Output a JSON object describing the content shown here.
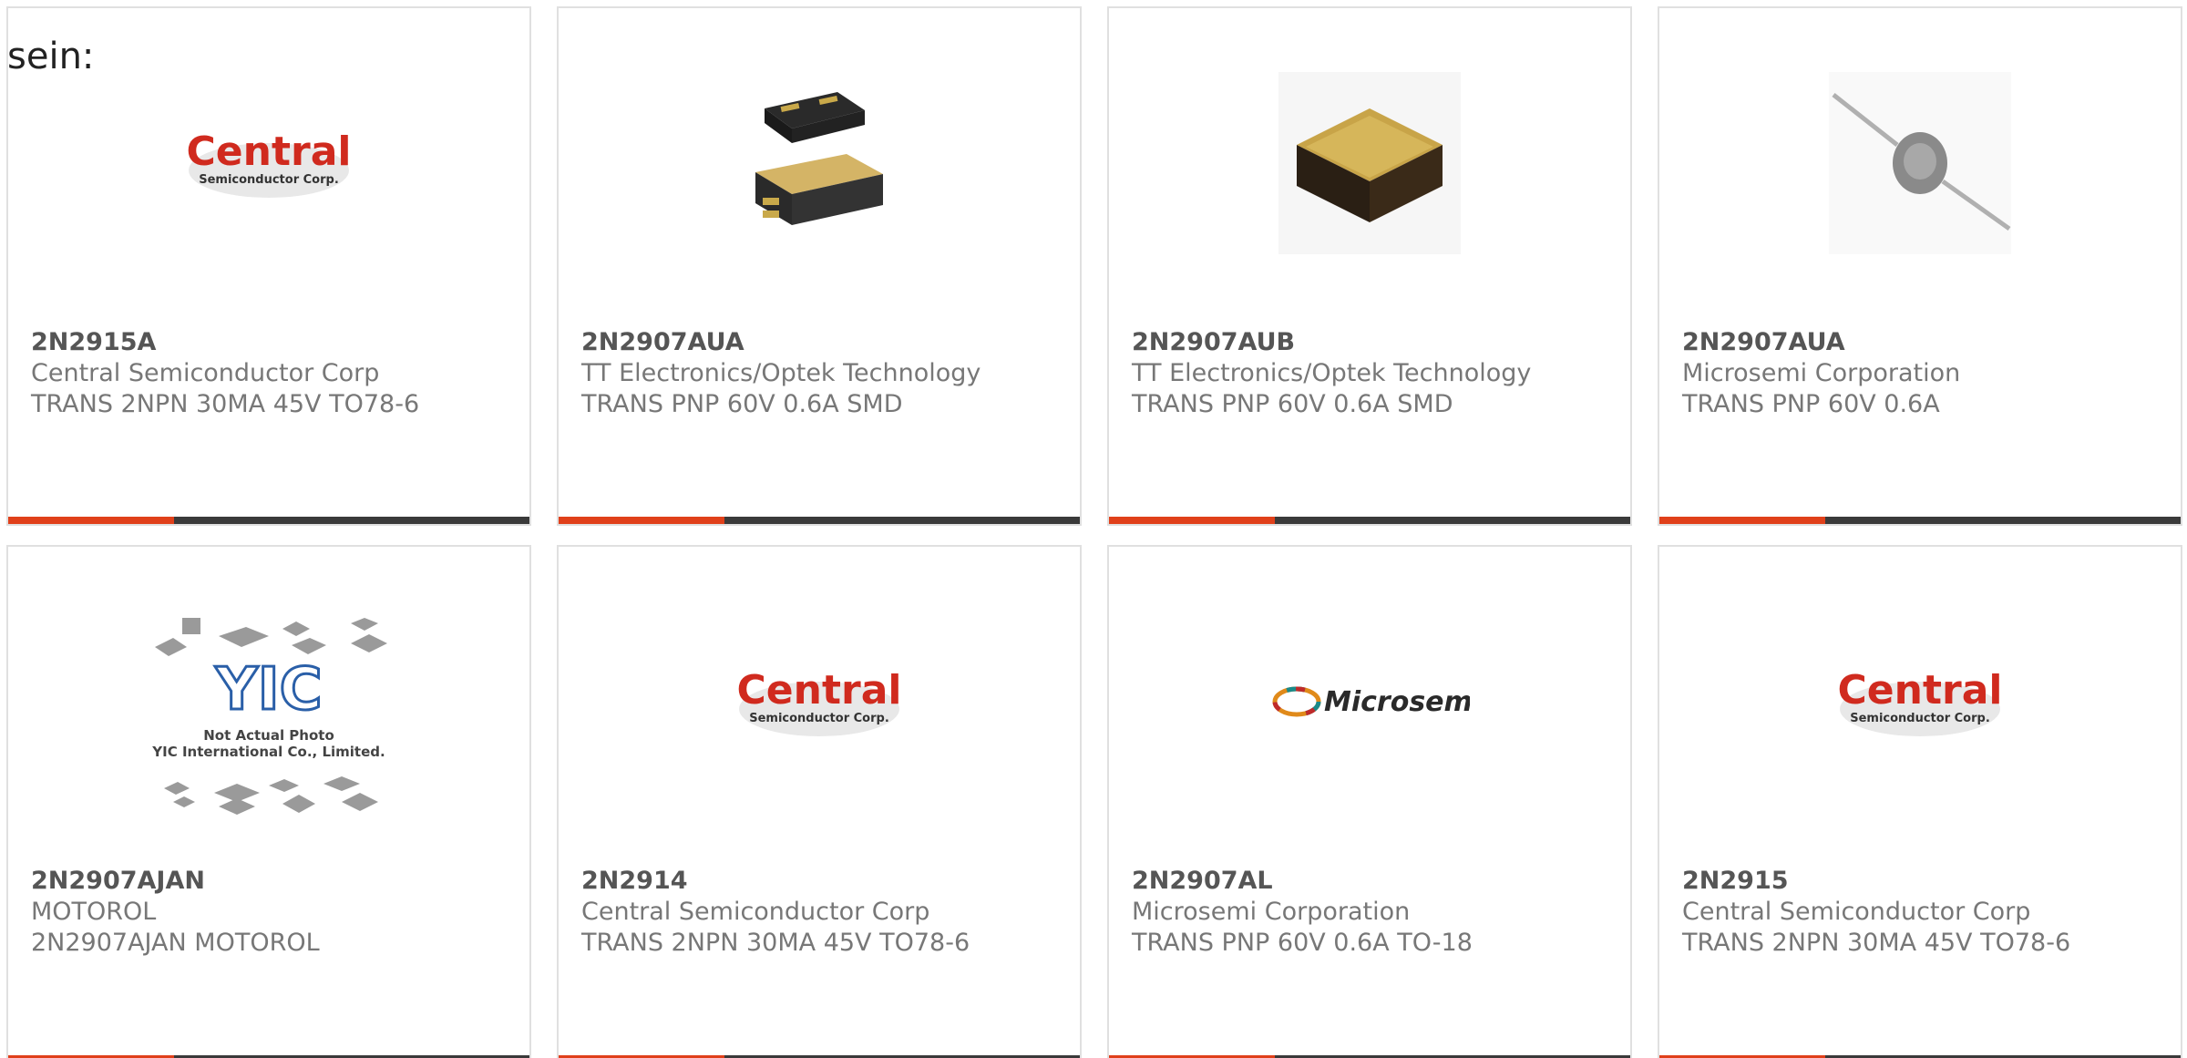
{
  "intro_text": "sein:",
  "colors": {
    "card_border": "#e0e0e0",
    "part_number": "#555555",
    "secondary_text": "#777777",
    "bar_dark": "#3a3a3a",
    "bar_accent": "#e0401a",
    "central_red": "#d02a1e"
  },
  "products": [
    {
      "part_number": "2N2915A",
      "manufacturer": "Central Semiconductor Corp",
      "description": "TRANS 2NPN 30MA 45V TO78-6",
      "image": "central-logo",
      "logo_main": "Central",
      "logo_sub": "Semiconductor Corp."
    },
    {
      "part_number": "2N2907AUA",
      "manufacturer": "TT Electronics/Optek Technology",
      "description": "TRANS PNP 60V 0.6A SMD",
      "image": "smd-package-photo"
    },
    {
      "part_number": "2N2907AUB",
      "manufacturer": "TT Electronics/Optek Technology",
      "description": "TRANS PNP 60V 0.6A SMD",
      "image": "smd-gold-package-photo"
    },
    {
      "part_number": "2N2907AUA",
      "manufacturer": "Microsemi Corporation",
      "description": "TRANS PNP 60V 0.6A",
      "image": "axial-diode-photo"
    },
    {
      "part_number": "2N2907AJAN",
      "manufacturer": "MOTOROL",
      "description": "2N2907AJAN MOTOROL",
      "image": "yic-placeholder",
      "placeholder_brand": "YIC",
      "placeholder_line1": "Not Actual Photo",
      "placeholder_line2": "YIC International Co., Limited."
    },
    {
      "part_number": "2N2914",
      "manufacturer": "Central Semiconductor Corp",
      "description": "TRANS 2NPN 30MA 45V TO78-6",
      "image": "central-logo",
      "logo_main": "Central",
      "logo_sub": "Semiconductor Corp."
    },
    {
      "part_number": "2N2907AL",
      "manufacturer": "Microsemi Corporation",
      "description": "TRANS PNP 60V 0.6A TO-18",
      "image": "microsemi-logo",
      "logo_main": "Microsemi"
    },
    {
      "part_number": "2N2915",
      "manufacturer": "Central Semiconductor Corp",
      "description": "TRANS 2NPN 30MA 45V TO78-6",
      "image": "central-logo",
      "logo_main": "Central",
      "logo_sub": "Semiconductor Corp."
    }
  ]
}
